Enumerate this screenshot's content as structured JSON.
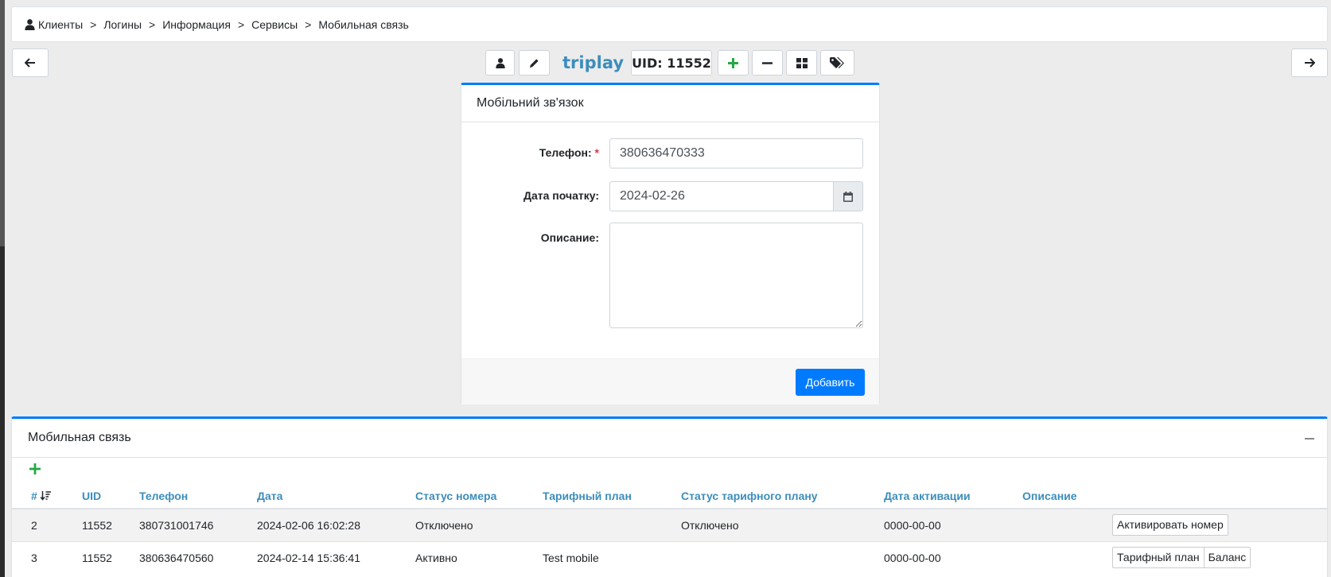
{
  "breadcrumb": {
    "items": [
      "Клиенты",
      "Логины",
      "Информация",
      "Сервисы",
      "Мобильная связь"
    ],
    "separator": ">"
  },
  "toolbar": {
    "login_name": "triplay",
    "uid_label": "UID: 11552",
    "icons": [
      "arrow-left-icon",
      "user-icon",
      "pencil-icon",
      "plus-icon",
      "minus-icon",
      "grid-icon",
      "tags-icon",
      "arrow-right-icon"
    ]
  },
  "form": {
    "title": "Мобільний зв'язок",
    "phone_label": "Телефон:",
    "required_mark": "*",
    "phone_value": "380636470333",
    "date_label": "Дата початку:",
    "date_value": "2024-02-26",
    "description_label": "Описание:",
    "description_value": "",
    "submit_label": "Добавить"
  },
  "list": {
    "title": "Мобильная связь",
    "columns": [
      "#",
      "UID",
      "Телефон",
      "Дата",
      "Статус номера",
      "Тарифный план",
      "Статус тарифного плану",
      "Дата активации",
      "Описание",
      ""
    ],
    "rows": [
      {
        "num": "2",
        "uid": "11552",
        "phone": "380731001746",
        "date": "2024-02-06 16:02:28",
        "number_status": "Отключено",
        "tariff": "",
        "tariff_status": "Отключено",
        "activation_date": "0000-00-00",
        "description": "",
        "actions": [
          "Активировать номер"
        ]
      },
      {
        "num": "3",
        "uid": "11552",
        "phone": "380636470560",
        "date": "2024-02-14 15:36:41",
        "number_status": "Активно",
        "tariff": "Test mobile",
        "tariff_status": "",
        "activation_date": "0000-00-00",
        "description": "",
        "actions": [
          "Тарифный план",
          "Баланс"
        ]
      }
    ]
  },
  "colors": {
    "accent": "#007bff",
    "link": "#3c8dbc",
    "success": "#28a745",
    "required": "#dc3545"
  }
}
